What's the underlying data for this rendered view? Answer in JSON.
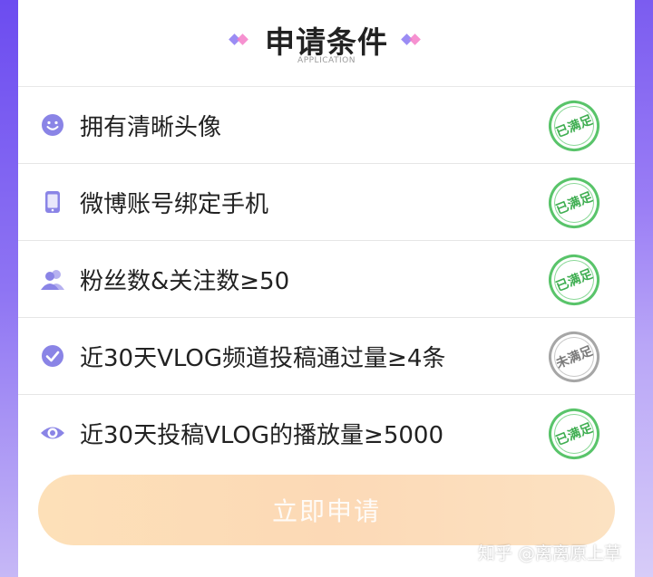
{
  "header": {
    "title": "申请条件",
    "subtitle": "APPLICATION"
  },
  "conditions": [
    {
      "label": "拥有清晰头像",
      "icon": "smiley-face-icon",
      "status": "已满足",
      "met": true
    },
    {
      "label": "微博账号绑定手机",
      "icon": "mobile-phone-icon",
      "status": "已满足",
      "met": true
    },
    {
      "label": "粉丝数&关注数≥50",
      "icon": "users-icon",
      "status": "已满足",
      "met": true
    },
    {
      "label": "近30天VLOG频道投稿通过量≥4条",
      "icon": "check-circle-icon",
      "status": "未满足",
      "met": false
    },
    {
      "label": "近30天投稿VLOG的播放量≥5000",
      "icon": "eye-icon",
      "status": "已满足",
      "met": true
    }
  ],
  "apply_button": {
    "label": "立即申请"
  },
  "watermark": "知乎 @离离原上草",
  "colors": {
    "accent": "#7b5cf0",
    "icon": "#8a84e6",
    "met": "#3fae51",
    "unmet": "#7a7a7a",
    "button": "#fcd9b6"
  }
}
